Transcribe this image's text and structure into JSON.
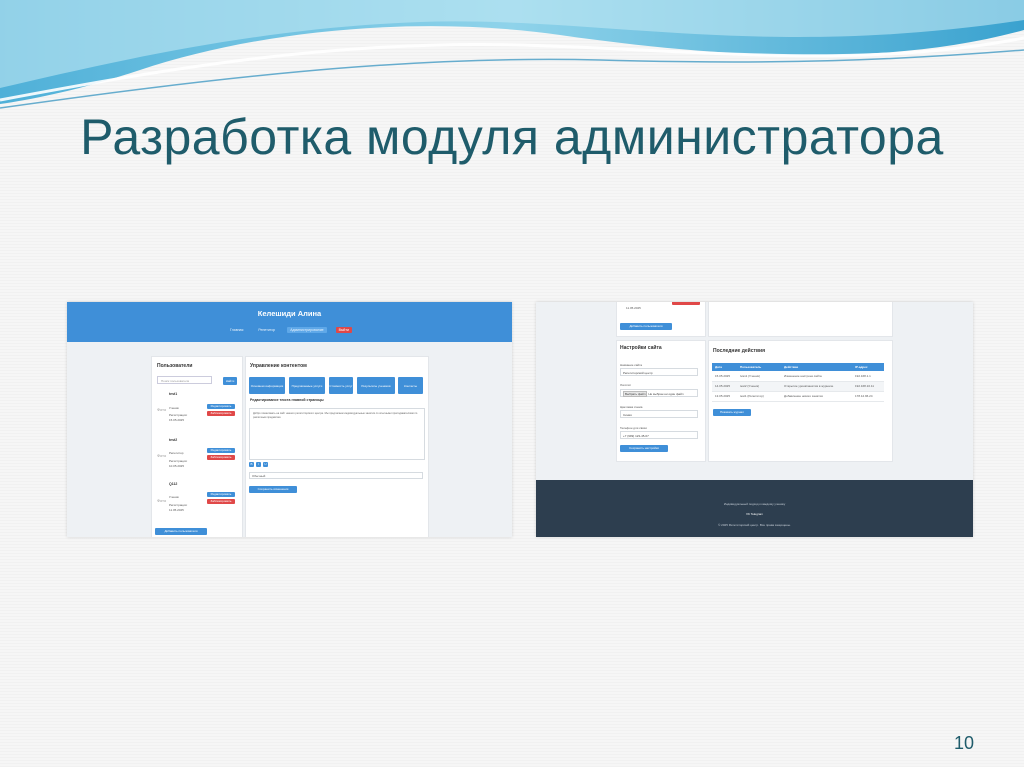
{
  "slide": {
    "title": "Разработка модуля администратора",
    "page_number": "10"
  },
  "colors": {
    "accent": "#3f8fd8",
    "title": "#1f5c6b",
    "danger": "#e04848",
    "footer": "#2d3e4f"
  },
  "left_screenshot": {
    "header_name": "Келешиди Алина",
    "nav": [
      "Главная",
      "Репетитор",
      "Администрирование",
      "Выйти"
    ],
    "users_panel": {
      "heading": "Пользователи",
      "search_placeholder": "Поиск пользователя",
      "search_button": "Найти",
      "users": [
        {
          "name": "test1",
          "avatar": "Фото",
          "role": "Ученик",
          "registered_label": "Регистрация:",
          "registered": "15.05.2025",
          "edit": "Редактировать",
          "delete": "Заблокировать"
        },
        {
          "name": "test2",
          "avatar": "Фото",
          "role": "Репетитор",
          "registered_label": "Регистрация:",
          "registered": "10.05.2025",
          "edit": "Редактировать",
          "delete": "Заблокировать"
        },
        {
          "name": "Q112",
          "avatar": "Фото",
          "role": "Ученик",
          "registered_label": "Регистрация:",
          "registered": "11.05.2025",
          "edit": "Редактировать",
          "delete": "Заблокировать"
        }
      ],
      "add_button": "Добавить пользователя"
    },
    "content_panel": {
      "heading": "Управление контентом",
      "tabs": [
        "Основная информация",
        "Предлагаемые услуги",
        "Стоимость услуг",
        "Результаты учеников",
        "Контакты"
      ],
      "edit_heading": "Редактирование текста главной страницы",
      "text_preview": "Добро пожаловать на сайт нашего репетиторского центра. Мы предлагаем индивидуальные занятия со опытными преподавателями по различным предметам.",
      "format_buttons": [
        "B",
        "I",
        "U"
      ],
      "select_value": "Обычный",
      "save_button": "Сохранить изменения"
    }
  },
  "right_screenshot": {
    "top_stub": {
      "date": "11.05.2025",
      "add_button": "Добавить пользователя"
    },
    "settings_panel": {
      "heading": "Настройки сайта",
      "site_name_label": "Название сайта",
      "site_name_value": "Репетиторский центр",
      "logo_label": "Логотип",
      "choose_file": "Выбрать файл",
      "file_status": "Не выбран ни один файл",
      "color_label": "Цветовая схема",
      "color_value": "Синяя",
      "phone_label": "Телефон для связи",
      "phone_value": "+7 (999) 123-45-67",
      "save_button": "Сохранить настройки"
    },
    "activity_panel": {
      "heading": "Последние действия",
      "columns": [
        "Дата",
        "Пользователь",
        "Действие",
        "IP-адрес"
      ],
      "rows": [
        [
          "15.05.2025",
          "Ivan1 (Ученик)",
          "Изменение настроек сайта",
          "192.168.1.1"
        ],
        [
          "14.05.2025",
          "test2 (Ученик)",
          "Открытие урока/занятия в журнале",
          "192.168.10.11"
        ],
        [
          "13.05.2025",
          "test1 (Репетитор)",
          "Добавление нового занятия",
          "178.12.96.24"
        ]
      ],
      "show_all_button": "Показать журнал"
    },
    "footer": {
      "line1": "Индивидуальный подход к каждому ученику",
      "links": "VK   Telegram",
      "copyright": "© 2025 Репетиторский центр. Все права защищены."
    }
  }
}
